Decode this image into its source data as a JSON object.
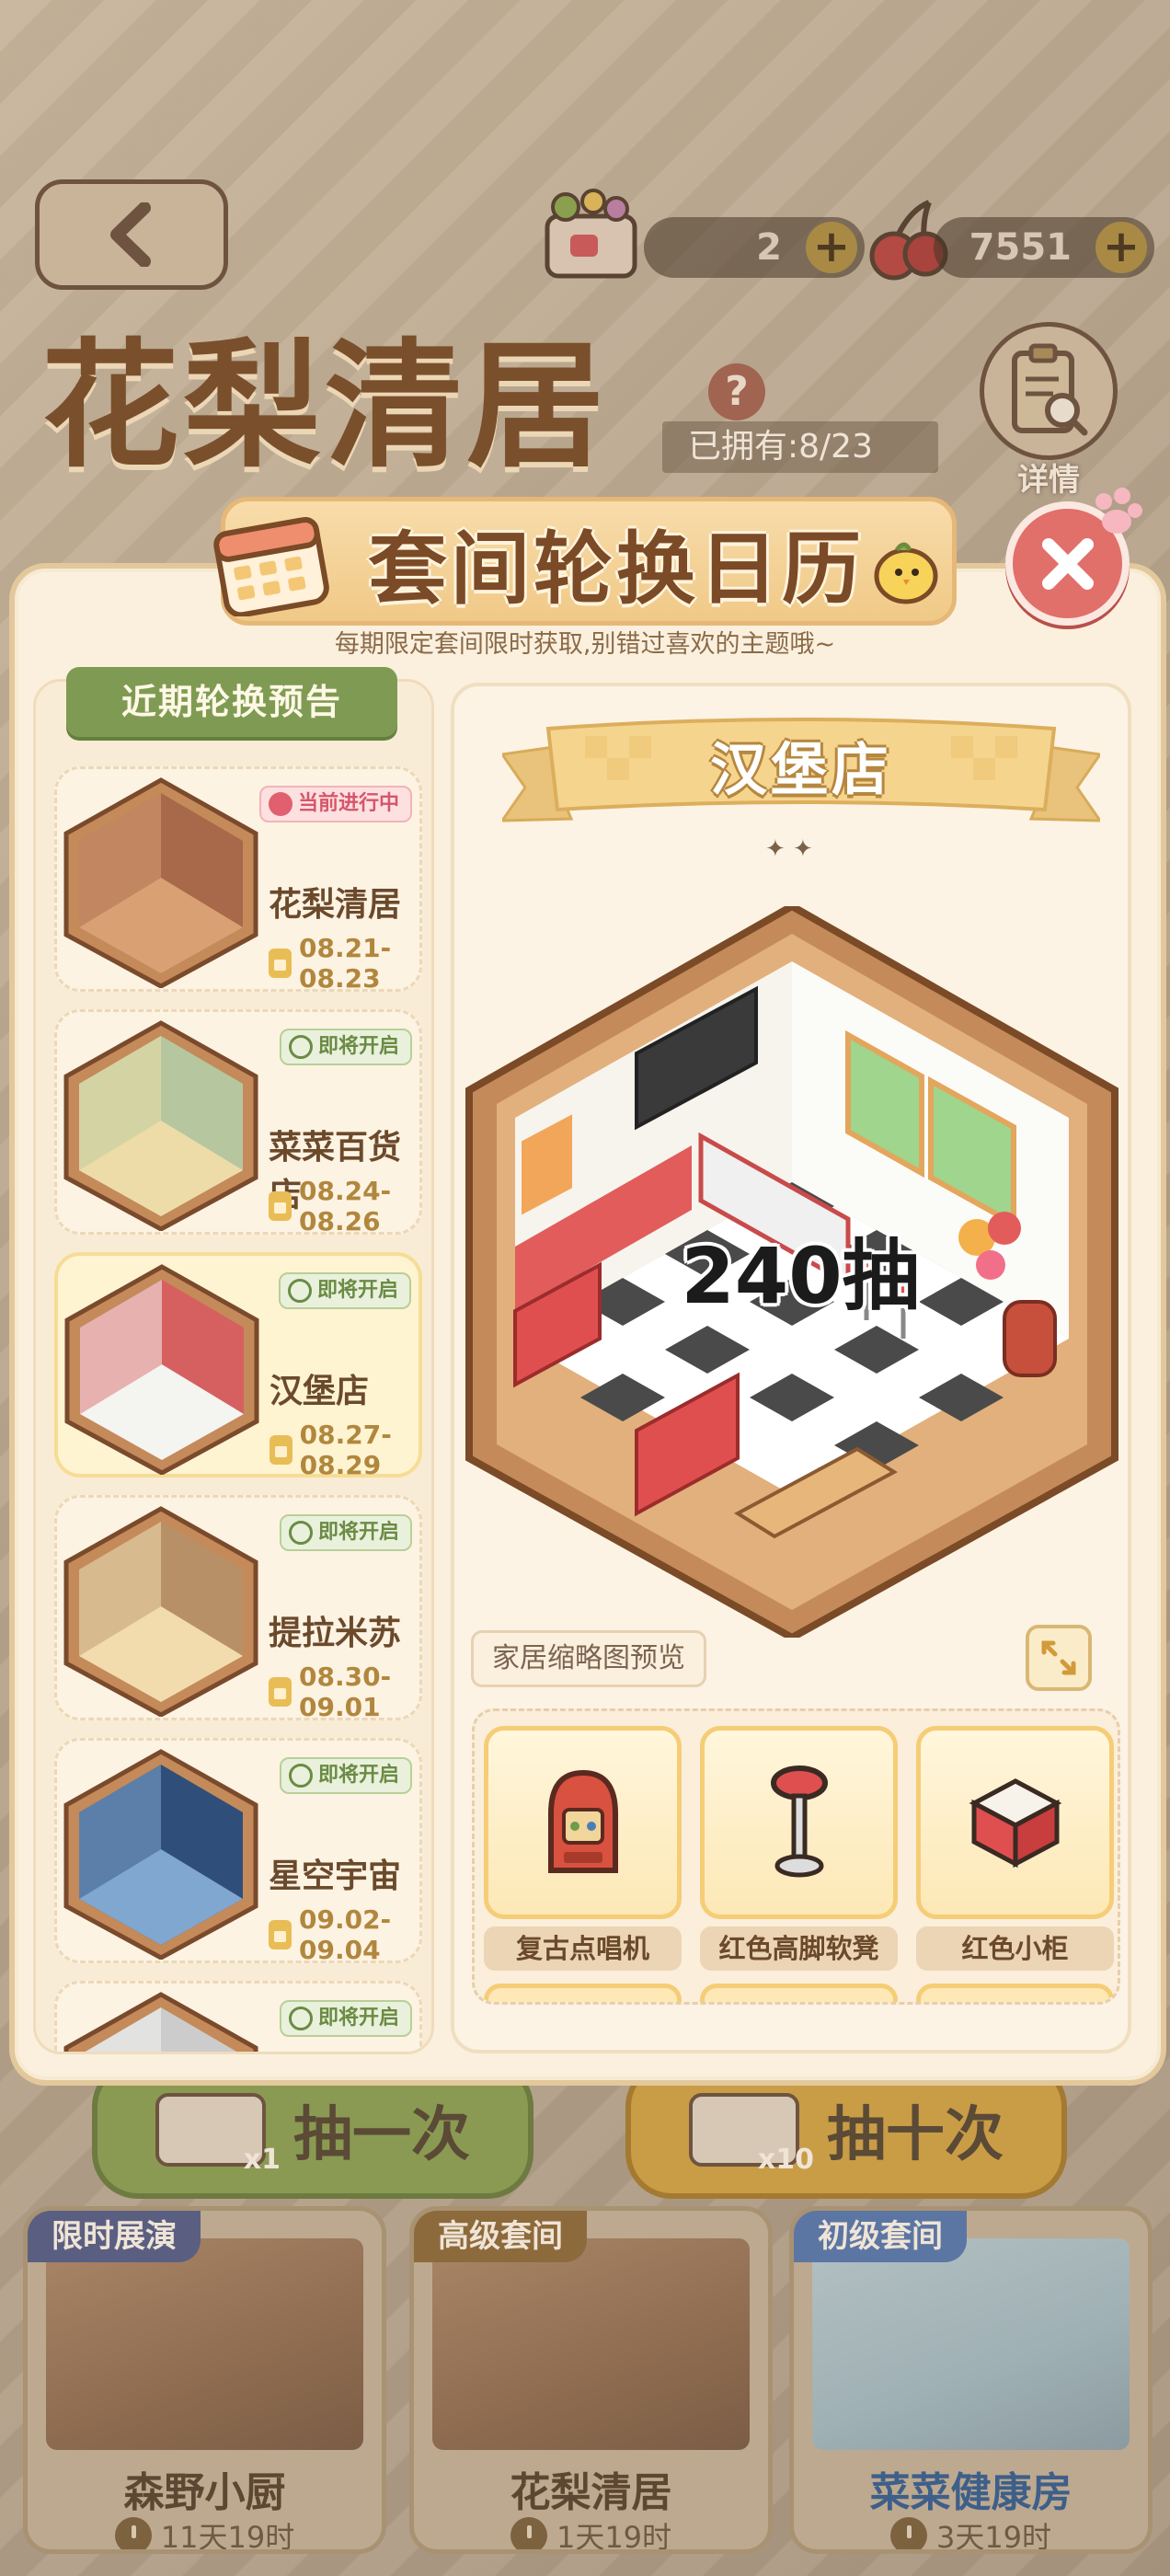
{
  "background": {
    "back_icon": "chevron-left-icon",
    "resources": [
      {
        "icon": "ticket-icon",
        "value": "2"
      },
      {
        "icon": "cherry-icon",
        "value": "7551"
      }
    ],
    "title": "花梨清居",
    "help_icon": "question-icon",
    "help_glyph": "?",
    "owned": "已拥有:8/23",
    "detail_label": "详情",
    "draw_buttons": [
      {
        "label": "抽一次",
        "multiplier": "x1"
      },
      {
        "label": "抽十次",
        "multiplier": "x10"
      }
    ],
    "mode_cards": [
      {
        "tag": "限时展演",
        "name": "森野小厨",
        "time": "11天19时"
      },
      {
        "tag": "高级套间",
        "name": "花梨清居",
        "time": "1天19时"
      },
      {
        "tag": "初级套间",
        "name": "菜菜健康房",
        "time": "3天19时"
      }
    ]
  },
  "modal": {
    "title": "套间轮换日历",
    "subtitle": "每期限定套间限时获取,别错过喜欢的主题哦~",
    "close_icon": "close-icon",
    "list_header": "近期轮换预告",
    "rotation_list": [
      {
        "name": "花梨清居",
        "date": "08.21-08.23",
        "status": "当前进行中",
        "status_type": "current"
      },
      {
        "name": "菜菜百货店",
        "date": "08.24-08.26",
        "status": "即将开启",
        "status_type": "soon"
      },
      {
        "name": "汉堡店",
        "date": "08.27-08.29",
        "status": "即将开启",
        "status_type": "soon",
        "selected": true
      },
      {
        "name": "提拉米苏",
        "date": "08.30-09.01",
        "status": "即将开启",
        "status_type": "soon"
      },
      {
        "name": "星空宇宙",
        "date": "09.02-09.04",
        "status": "即将开启",
        "status_type": "soon"
      },
      {
        "name": "",
        "date": "",
        "status": "即将开启",
        "status_type": "soon"
      }
    ],
    "detail": {
      "name": "汉堡店",
      "sparkles": "✦ ✦",
      "draws": "240抽",
      "preview_label": "家居缩略图预览",
      "expand_icon": "expand-icon",
      "furniture": [
        {
          "name": "复古点唱机",
          "icon": "jukebox-icon"
        },
        {
          "name": "红色高脚软凳",
          "icon": "bar-stool-icon"
        },
        {
          "name": "红色小柜",
          "icon": "red-cabinet-icon"
        }
      ]
    }
  },
  "colors": {
    "accent_green": "#7f9b53",
    "accent_gold": "#f5cd76",
    "title_brown": "#7b4a26",
    "close_red": "#e16f6a",
    "badge_current": "#d6566a",
    "badge_soon": "#6b8b44"
  }
}
